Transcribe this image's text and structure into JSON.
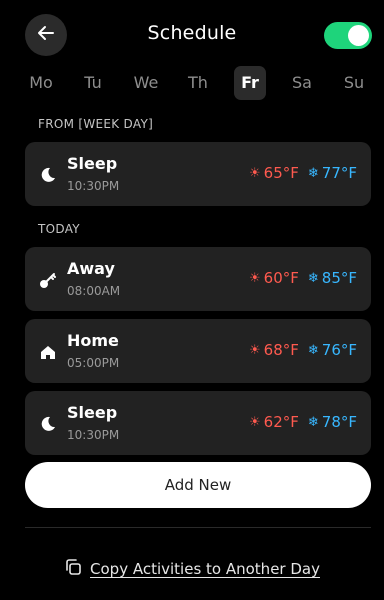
{
  "header": {
    "back_icon": "arrow-left-icon",
    "title": "Schedule",
    "toggle_on": true,
    "toggle_color": "#1ed47b"
  },
  "days": [
    {
      "label": "Mo",
      "selected": false
    },
    {
      "label": "Tu",
      "selected": false
    },
    {
      "label": "We",
      "selected": false
    },
    {
      "label": "Th",
      "selected": false
    },
    {
      "label": "Fr",
      "selected": true
    },
    {
      "label": "Sa",
      "selected": false
    },
    {
      "label": "Su",
      "selected": false
    }
  ],
  "sections": {
    "from_label": "FROM [WEEK DAY]",
    "today_label": "TODAY"
  },
  "from_entries": [
    {
      "icon": "moon-icon",
      "name": "Sleep",
      "time": "10:30PM",
      "heat": "65°F",
      "cool": "77°F"
    }
  ],
  "today_entries": [
    {
      "icon": "key-icon",
      "name": "Away",
      "time": "08:00AM",
      "heat": "60°F",
      "cool": "85°F"
    },
    {
      "icon": "home-icon",
      "name": "Home",
      "time": "05:00PM",
      "heat": "68°F",
      "cool": "76°F"
    },
    {
      "icon": "moon-icon",
      "name": "Sleep",
      "time": "10:30PM",
      "heat": "62°F",
      "cool": "78°F"
    }
  ],
  "add_button_label": "Add New",
  "copy_link": {
    "icon": "copy-icon",
    "label": "Copy Activities to Another Day"
  },
  "colors": {
    "heat": "#ff5a4f",
    "cool": "#38b7ff",
    "card": "#222222",
    "background": "#000000"
  }
}
